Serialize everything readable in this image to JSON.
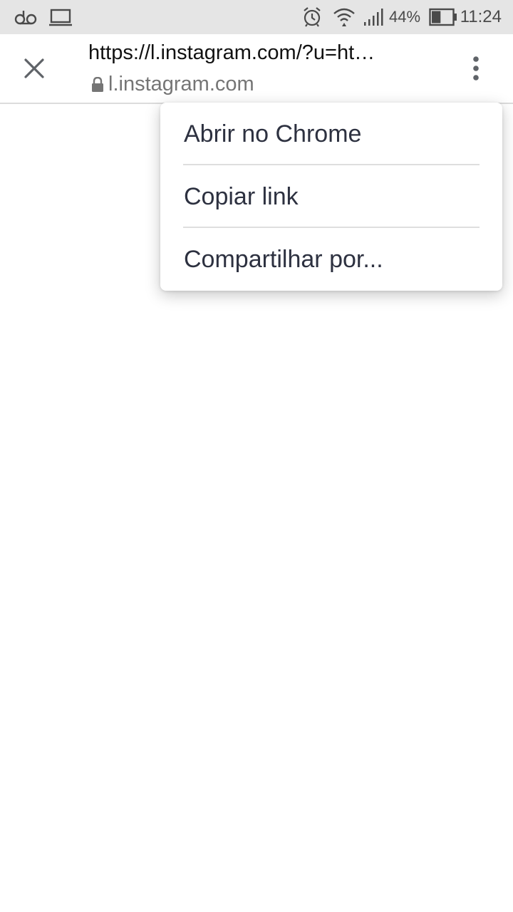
{
  "status_bar": {
    "left_icons": [
      "voicemail-icon",
      "laptop-icon"
    ],
    "right_icons": [
      "alarm-icon",
      "wifi-icon",
      "signal-icon",
      "battery-icon"
    ],
    "battery_percent": "44%",
    "battery_level": 0.44,
    "time": "11:24"
  },
  "toolbar": {
    "close_icon": "close-icon",
    "url": "https://l.instagram.com/?u=ht…",
    "domain": "l.instagram.com",
    "lock_icon": "lock-icon",
    "menu_icon": "more-vert-icon"
  },
  "menu": {
    "items": [
      {
        "label": "Abrir no Chrome"
      },
      {
        "label": "Copiar link"
      },
      {
        "label": "Compartilhar por..."
      }
    ]
  },
  "colors": {
    "status_bar_bg": "#e5e5e5",
    "menu_text": "#2d3140",
    "domain_text": "#757575",
    "icon_gray": "#5f6368"
  }
}
